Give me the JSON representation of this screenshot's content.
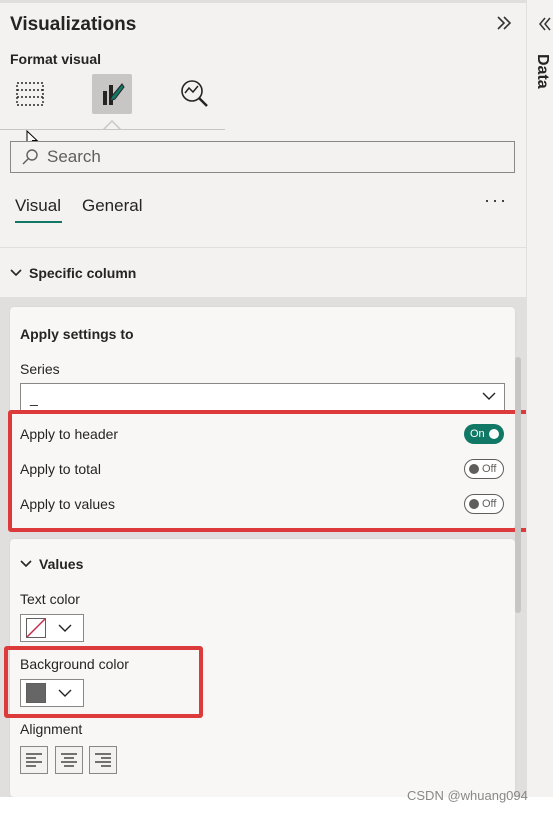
{
  "pane": {
    "title": "Visualizations",
    "format_label": "Format visual",
    "collapse_icon": "double-chevron-right"
  },
  "search": {
    "placeholder": "Search"
  },
  "tabs": [
    {
      "label": "Visual",
      "active": true
    },
    {
      "label": "General",
      "active": false
    }
  ],
  "more_label": "···",
  "section": {
    "title": "Specific column"
  },
  "apply_card": {
    "title": "Apply settings to",
    "series_label": "Series",
    "series_value": "_",
    "toggles": [
      {
        "label": "Apply to header",
        "state": "On"
      },
      {
        "label": "Apply to total",
        "state": "Off"
      },
      {
        "label": "Apply to values",
        "state": "Off"
      }
    ]
  },
  "values_card": {
    "title": "Values",
    "text_color_label": "Text color",
    "background_color_label": "Background color",
    "background_color": "#666666",
    "alignment_label": "Alignment",
    "alignment_options": [
      "align-left",
      "align-center",
      "align-right"
    ]
  },
  "right_rail": {
    "label": "Data"
  },
  "watermark": "CSDN @whuang094",
  "colors": {
    "accent": "#117865",
    "highlight": "#dd3b3b"
  }
}
